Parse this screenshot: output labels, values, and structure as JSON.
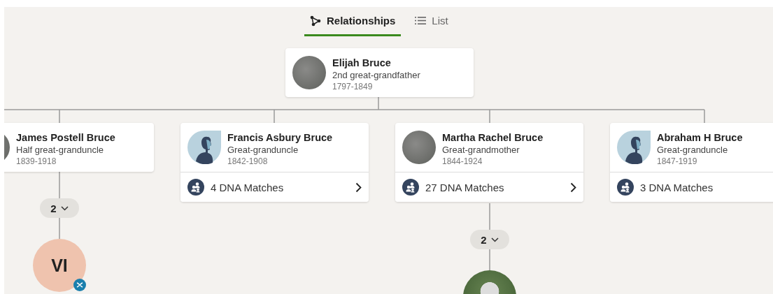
{
  "tabs": [
    {
      "label": "Relationships",
      "kind": "network",
      "selected": true
    },
    {
      "label": "List",
      "kind": "list",
      "selected": false
    }
  ],
  "focus_person": {
    "name": "Elijah Bruce",
    "relation": "2nd great-grandfather",
    "years": "1797-1849",
    "kind": "photo"
  },
  "children": [
    {
      "name": "James Postell Bruce",
      "relation": "Half great-granduncle",
      "years": "1839-1918",
      "kind": "photo",
      "descendants": {
        "count": "2",
        "first": {
          "kind": "initials",
          "initials": "VI",
          "dna_badge": true
        }
      }
    },
    {
      "name": "Francis Asbury Bruce",
      "relation": "Great-granduncle",
      "years": "1842-1908",
      "kind": "silhouette",
      "dna_matches": "4 DNA Matches",
      "link": true
    },
    {
      "name": "Martha Rachel Bruce",
      "relation": "Great-grandmother",
      "years": "1844-1924",
      "kind": "photo",
      "dna_matches": "27 DNA Matches",
      "link": true,
      "descendants": {
        "count": "2",
        "first": {
          "kind": "photo",
          "dna_badge": false
        }
      }
    },
    {
      "name": "Abraham H Bruce",
      "relation": "Great-granduncle",
      "years": "1847-1919",
      "kind": "silhouette",
      "dna_matches": "3 DNA Matches",
      "link": false
    }
  ]
}
